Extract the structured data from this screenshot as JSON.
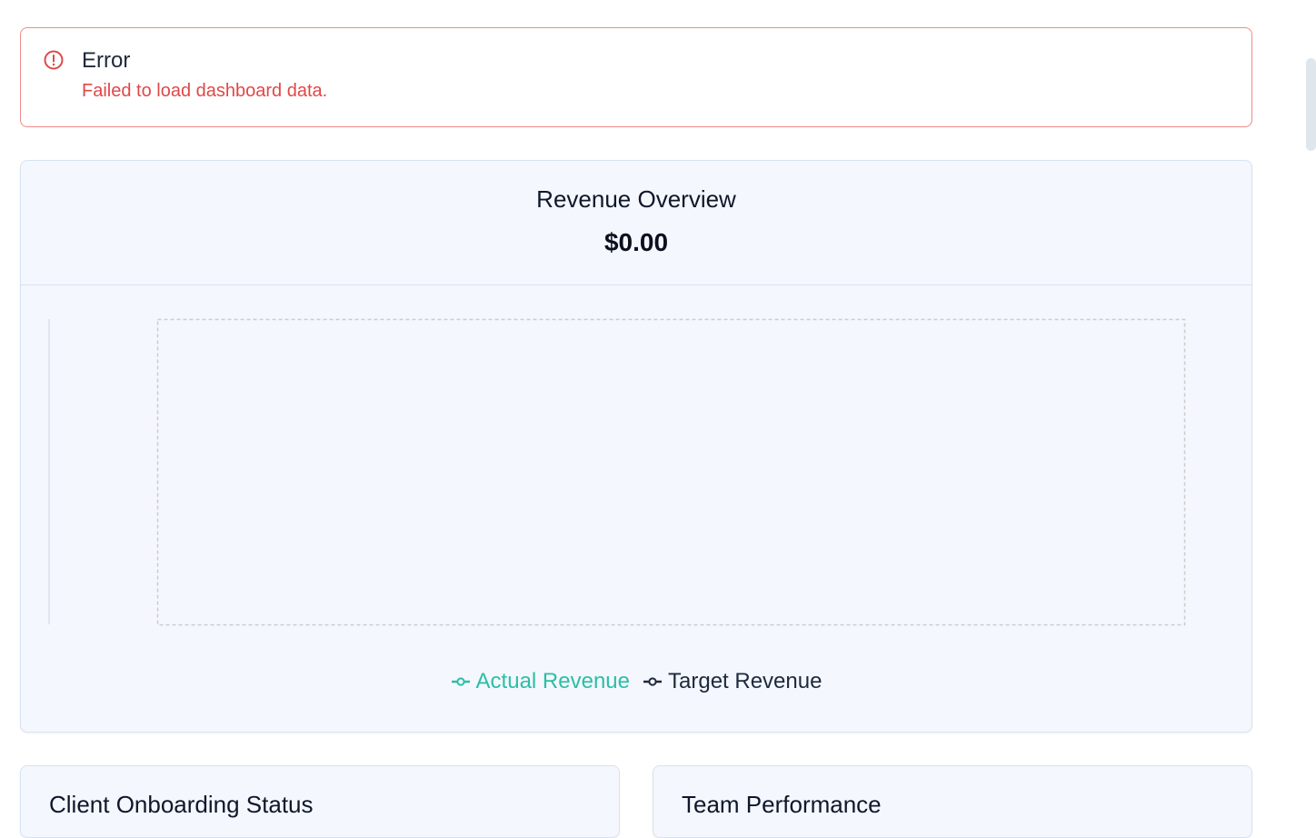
{
  "alert": {
    "title": "Error",
    "message": "Failed to load dashboard data.",
    "icon": "alert-circle-icon",
    "color": "#e04848"
  },
  "revenue": {
    "title": "Revenue Overview",
    "total": "$0.00",
    "legend": [
      {
        "label": "Actual Revenue",
        "color": "#2bbfa6",
        "icon": "line-dot-icon"
      },
      {
        "label": "Target Revenue",
        "color": "#1e293b",
        "icon": "line-dot-icon"
      }
    ]
  },
  "chart_data": {
    "type": "line",
    "title": "Revenue Overview",
    "categories": [],
    "series": [
      {
        "name": "Actual Revenue",
        "values": []
      },
      {
        "name": "Target Revenue",
        "values": []
      }
    ],
    "grid": true,
    "legend_position": "bottom-center"
  },
  "sections": {
    "onboarding_title": "Client Onboarding Status",
    "team_title": "Team Performance"
  }
}
